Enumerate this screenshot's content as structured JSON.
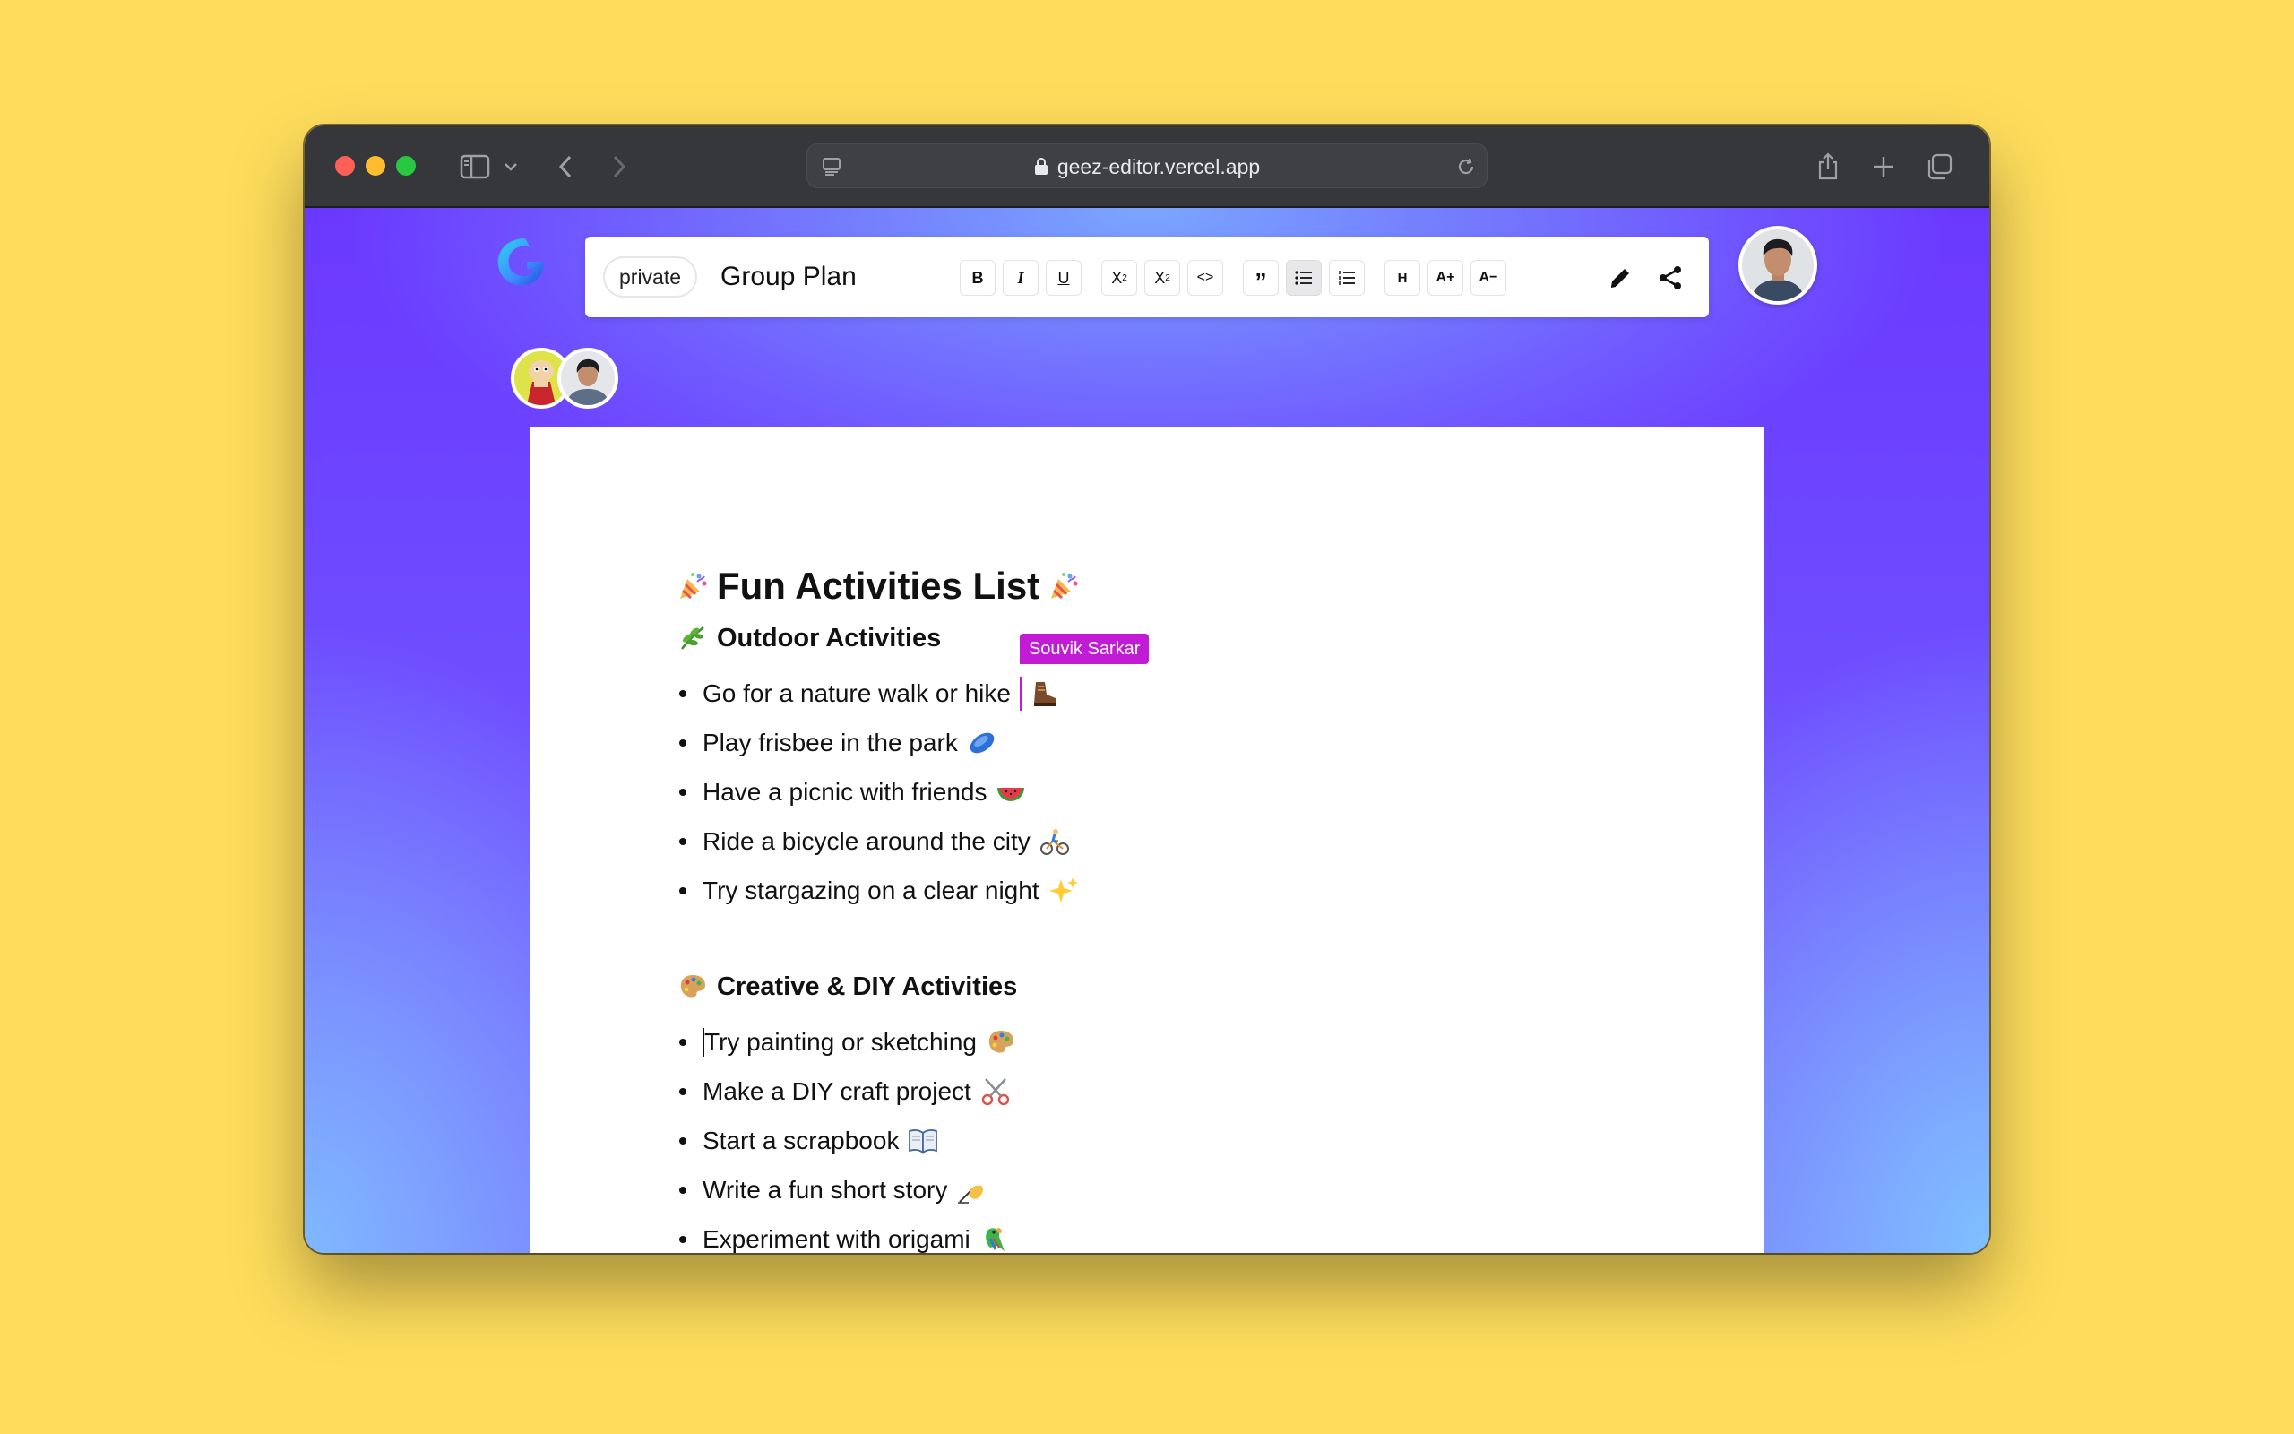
{
  "browser": {
    "url": "geez-editor.vercel.app"
  },
  "editor": {
    "privacy": "private",
    "title": "Group Plan",
    "format_buttons": [
      {
        "name": "bold-button",
        "label": "B"
      },
      {
        "name": "italic-button",
        "label": "I"
      },
      {
        "name": "underline-button",
        "label": "U"
      },
      {
        "name": "subscript-button",
        "label": "X"
      },
      {
        "name": "superscript-button",
        "label": "X"
      },
      {
        "name": "code-button",
        "label": "<>"
      },
      {
        "name": "blockquote-button",
        "label": "”"
      },
      {
        "name": "bullet-list-button",
        "label": ""
      },
      {
        "name": "ordered-list-button",
        "label": ""
      },
      {
        "name": "heading-button",
        "label": "H"
      },
      {
        "name": "font-increase-button",
        "label": "A+"
      },
      {
        "name": "font-decrease-button",
        "label": "A−"
      }
    ],
    "active_button": "bullet-list-button"
  },
  "document": {
    "heading": "Fun Activities List",
    "sections": [
      {
        "title": "Outdoor Activities",
        "items": [
          "Go for a nature walk or hike",
          "Play frisbee in the park",
          "Have a picnic with friends",
          "Ride a bicycle around the city",
          "Try stargazing on a clear night"
        ]
      },
      {
        "title": "Creative & DIY Activities",
        "items": [
          "Try painting or sketching",
          "Make a DIY craft project",
          "Start a scrapbook",
          "Write a fun short story",
          "Experiment with origami"
        ]
      }
    ]
  },
  "collaborator_cursor": {
    "name": "Souvik Sarkar",
    "color": "#C21BD6"
  },
  "colors": {
    "background": "#FEDD5C",
    "accent_purple": "#6B38FF"
  }
}
